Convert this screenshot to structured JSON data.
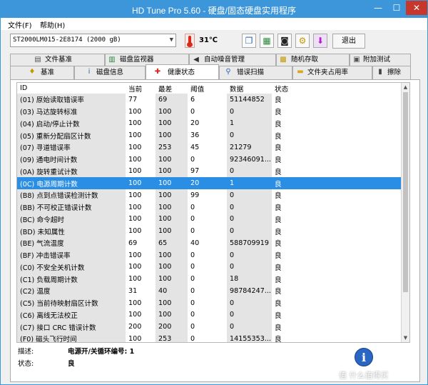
{
  "window": {
    "title": "HD Tune Pro 5.60 - 硬盘/固态硬盘实用程序",
    "minimize": "—",
    "maximize": "☐",
    "close": "✕"
  },
  "menu": {
    "file": "文件(F)",
    "help": "帮助(H)"
  },
  "toolbar": {
    "drive": "ST2000LM015-2E8174 (2000 gB)",
    "temperature": "31℃",
    "exit": "退出",
    "buttons": [
      "copy-icon",
      "save-icon",
      "camera-icon",
      "options-icon",
      "download-icon"
    ]
  },
  "tabs_row1": [
    "文件基准",
    "磁盘监视器",
    "自动噪音管理",
    "随机存取",
    "附加测试"
  ],
  "tabs_row2": [
    "基准",
    "磁盘信息",
    "健康状态",
    "错误扫描",
    "文件夹占用率",
    "擦除"
  ],
  "active_tab": "健康状态",
  "table": {
    "headers": [
      "ID",
      "当前",
      "最差",
      "阈值",
      "数据",
      "状态"
    ],
    "rows": [
      [
        "(01) 原始读取错误率",
        "77",
        "69",
        "6",
        "51144852",
        "良"
      ],
      [
        "(03) 马达旋转标准",
        "100",
        "100",
        "0",
        "0",
        "良"
      ],
      [
        "(04) 启动/停止计数",
        "100",
        "100",
        "20",
        "1",
        "良"
      ],
      [
        "(05) 重新分配扇区计数",
        "100",
        "100",
        "36",
        "0",
        "良"
      ],
      [
        "(07) 寻道错误率",
        "100",
        "253",
        "45",
        "21279",
        "良"
      ],
      [
        "(09) 通电时间计数",
        "100",
        "100",
        "0",
        "92346091...",
        "良"
      ],
      [
        "(0A) 旋转重试计数",
        "100",
        "100",
        "97",
        "0",
        "良"
      ],
      [
        "(0C) 电源周期计数",
        "100",
        "100",
        "20",
        "1",
        "良"
      ],
      [
        "(B8) 点到点错误检测计数",
        "100",
        "100",
        "99",
        "0",
        "良"
      ],
      [
        "(BB) 不可校正错误计数",
        "100",
        "100",
        "0",
        "0",
        "良"
      ],
      [
        "(BC) 命令超时",
        "100",
        "100",
        "0",
        "0",
        "良"
      ],
      [
        "(BD) 未知属性",
        "100",
        "100",
        "0",
        "0",
        "良"
      ],
      [
        "(BE) 气流温度",
        "69",
        "65",
        "40",
        "588709919",
        "良"
      ],
      [
        "(BF) 冲击错误率",
        "100",
        "100",
        "0",
        "0",
        "良"
      ],
      [
        "(C0) 不安全关机计数",
        "100",
        "100",
        "0",
        "0",
        "良"
      ],
      [
        "(C1) 负载周期计数",
        "100",
        "100",
        "0",
        "18",
        "良"
      ],
      [
        "(C2) 温度",
        "31",
        "40",
        "0",
        "98784247...",
        "良"
      ],
      [
        "(C5) 当前待映射扇区计数",
        "100",
        "100",
        "0",
        "0",
        "良"
      ],
      [
        "(C6) 离线无法校正",
        "100",
        "100",
        "0",
        "0",
        "良"
      ],
      [
        "(C7) 接口 CRC 错误计数",
        "200",
        "200",
        "0",
        "0",
        "良"
      ],
      [
        "(F0) 磁头飞行时间",
        "100",
        "253",
        "0",
        "14155353...",
        "良"
      ]
    ],
    "selected_row": 7
  },
  "details": {
    "desc_label": "描述:",
    "desc_value": "电源开/关循环编号: 1",
    "status_label": "状态:",
    "status_value": "良"
  },
  "watermark": "值 什么值得买"
}
